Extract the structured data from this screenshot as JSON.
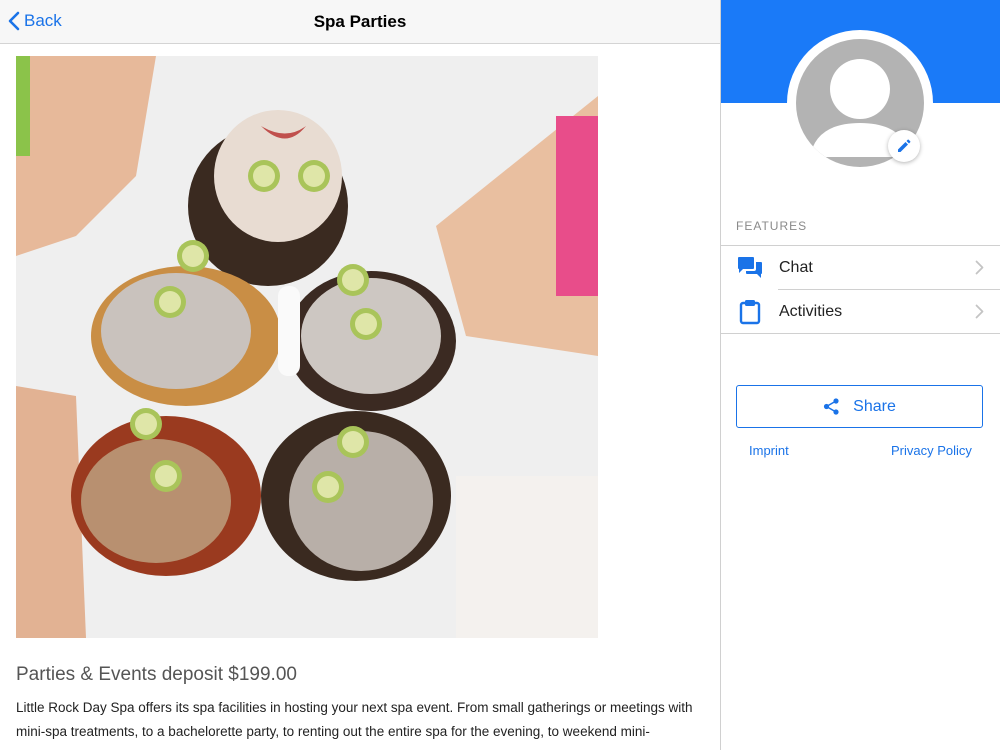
{
  "navbar": {
    "back_label": "Back",
    "title": "Spa Parties"
  },
  "hero": {
    "icon": "photo"
  },
  "event": {
    "title": "Parties & Events deposit $199.00",
    "description": "Little Rock Day Spa offers its spa facilities in hosting your next spa event. From small gatherings or meetings with mini-spa treatments, to a bachelorette party, to renting out the entire spa for the evening, to weekend mini-"
  },
  "profile": {
    "banner_color": "#1a7af8",
    "avatar_icon": "person-placeholder",
    "edit_icon": "pencil"
  },
  "features": {
    "section_label": "FEATURES",
    "items": [
      {
        "label": "Chat",
        "icon": "chat-bubbles"
      },
      {
        "label": "Activities",
        "icon": "clipboard"
      }
    ]
  },
  "share": {
    "label": "Share",
    "icon": "share"
  },
  "footer_links": {
    "imprint": "Imprint",
    "privacy": "Privacy Policy"
  },
  "colors": {
    "accent": "#1a73e8",
    "banner": "#1a7af8"
  }
}
